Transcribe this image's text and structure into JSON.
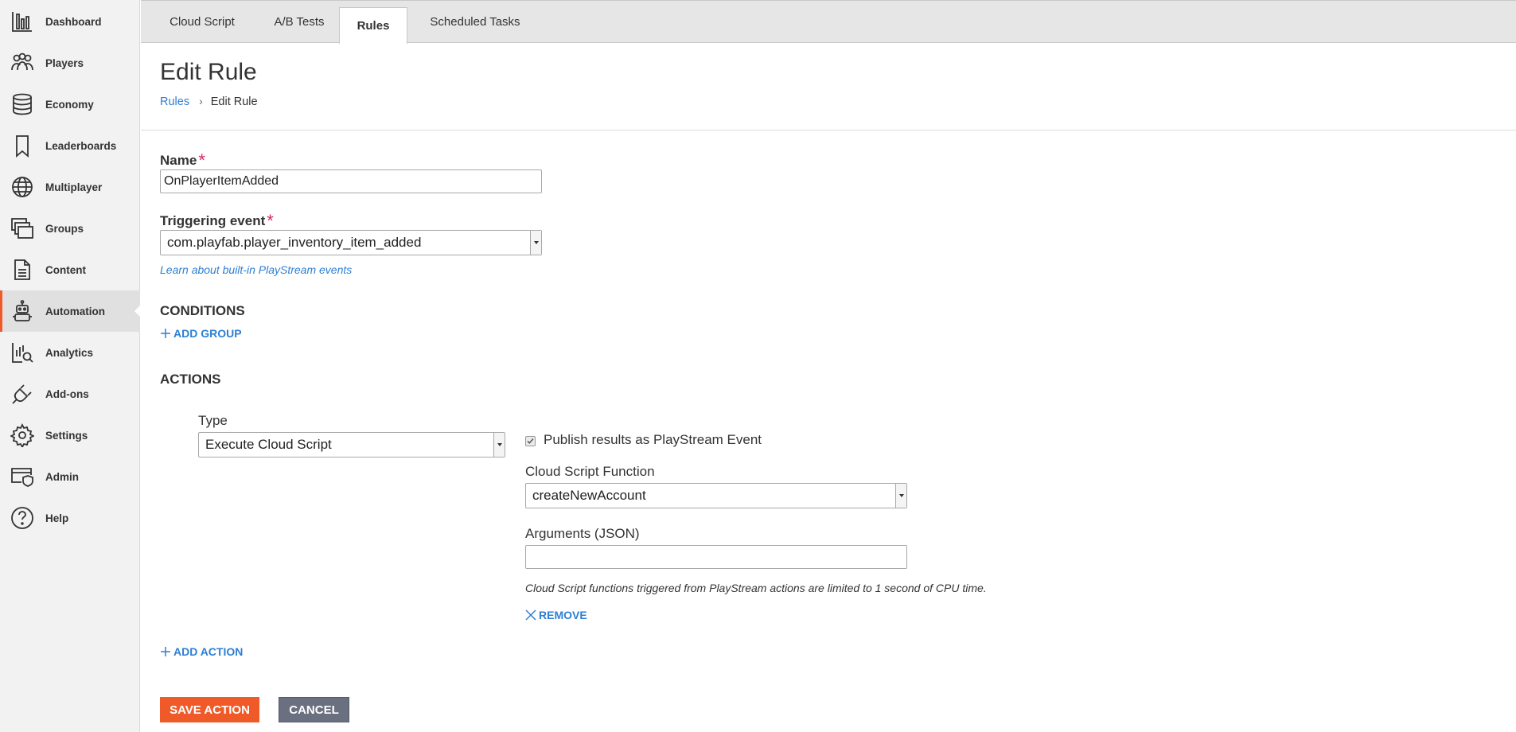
{
  "sidebar": {
    "items": [
      {
        "label": "Dashboard",
        "icon": "bar-chart-icon"
      },
      {
        "label": "Players",
        "icon": "players-icon"
      },
      {
        "label": "Economy",
        "icon": "coins-stack-icon"
      },
      {
        "label": "Leaderboards",
        "icon": "bookmark-icon"
      },
      {
        "label": "Multiplayer",
        "icon": "globe-icon"
      },
      {
        "label": "Groups",
        "icon": "stacked-windows-icon"
      },
      {
        "label": "Content",
        "icon": "document-icon"
      },
      {
        "label": "Automation",
        "icon": "robot-icon"
      },
      {
        "label": "Analytics",
        "icon": "analytics-search-icon"
      },
      {
        "label": "Add-ons",
        "icon": "plug-icon"
      },
      {
        "label": "Settings",
        "icon": "gear-icon"
      },
      {
        "label": "Admin",
        "icon": "shield-window-icon"
      },
      {
        "label": "Help",
        "icon": "question-circle-icon"
      }
    ],
    "active": "Automation"
  },
  "tabs": [
    {
      "label": "Cloud Script"
    },
    {
      "label": "A/B Tests"
    },
    {
      "label": "Rules"
    },
    {
      "label": "Scheduled Tasks"
    }
  ],
  "page": {
    "title": "Edit Rule",
    "breadcrumb": {
      "parent": "Rules",
      "current": "Edit Rule"
    }
  },
  "form": {
    "name_label": "Name",
    "name_value": "OnPlayerItemAdded",
    "event_label": "Triggering event",
    "event_value": "com.playfab.player_inventory_item_added",
    "learn_link": "Learn about built-in PlayStream events",
    "conditions_heading": "CONDITIONS",
    "add_group": "ADD GROUP",
    "actions_heading": "ACTIONS",
    "type_label": "Type",
    "type_value": "Execute Cloud Script",
    "publish_label": "Publish results as PlayStream Event",
    "publish_checked": true,
    "function_label": "Cloud Script Function",
    "function_value": "createNewAccount",
    "arguments_label": "Arguments (JSON)",
    "arguments_value": "",
    "cpu_note": "Cloud Script functions triggered from PlayStream actions are limited to 1 second of CPU time.",
    "remove": "REMOVE",
    "add_action": "ADD ACTION",
    "save_button": "SAVE ACTION",
    "cancel_button": "CANCEL"
  },
  "colors": {
    "accent": "#f05a28",
    "link": "#2d7fd3",
    "required": "#e0245e",
    "cancel_bg": "#6b7080"
  }
}
